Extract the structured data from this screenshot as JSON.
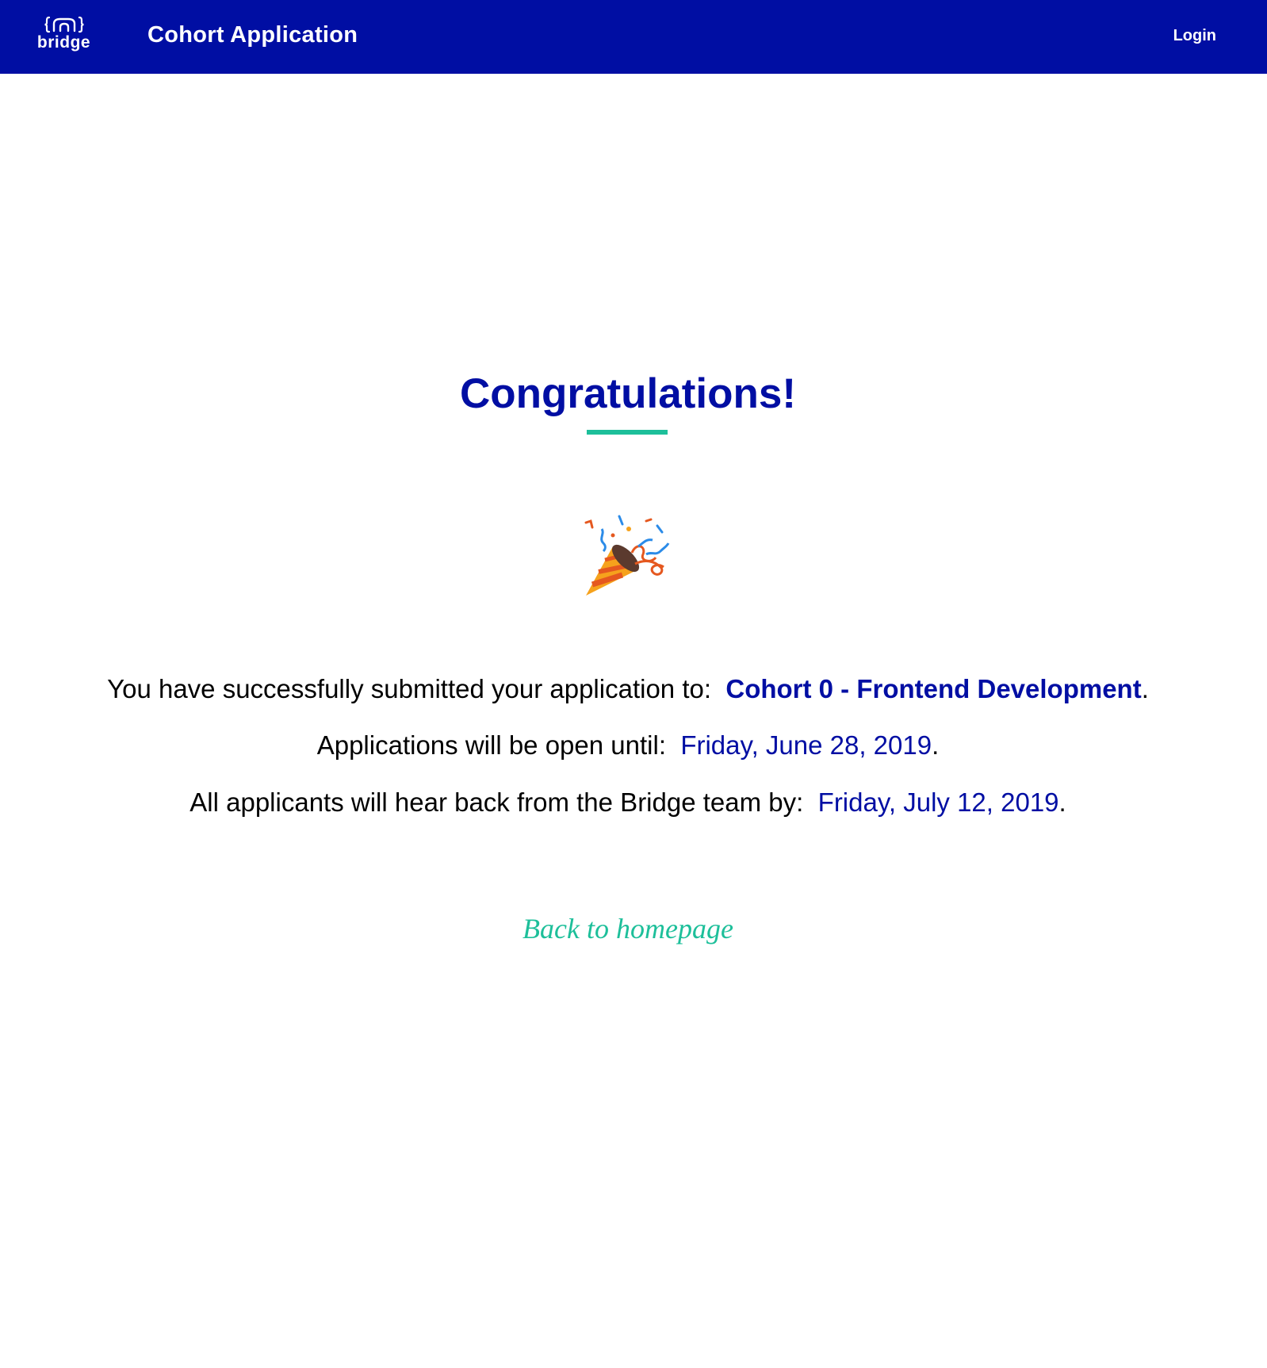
{
  "header": {
    "brand_word": "bridge",
    "brand_icon": "bridge-braces-icon",
    "title": "Cohort Application",
    "login_label": "Login"
  },
  "main": {
    "headline": "Congratulations!",
    "celebration_icon": "party-popper-icon",
    "line1": {
      "prefix": "You have successfully submitted your application to:",
      "value": "Cohort 0 - Frontend Development",
      "suffix": "."
    },
    "line2": {
      "prefix": "Applications will be open until:",
      "value": "Friday, June 28, 2019",
      "suffix": "."
    },
    "line3": {
      "prefix": "All applicants will hear back from the Bridge team by:",
      "value": "Friday, July 12, 2019",
      "suffix": "."
    },
    "back_link": "Back to homepage"
  },
  "colors": {
    "brand_blue": "#000ea3",
    "accent_teal": "#1dbf9a",
    "text": "#000000",
    "background": "#ffffff"
  }
}
